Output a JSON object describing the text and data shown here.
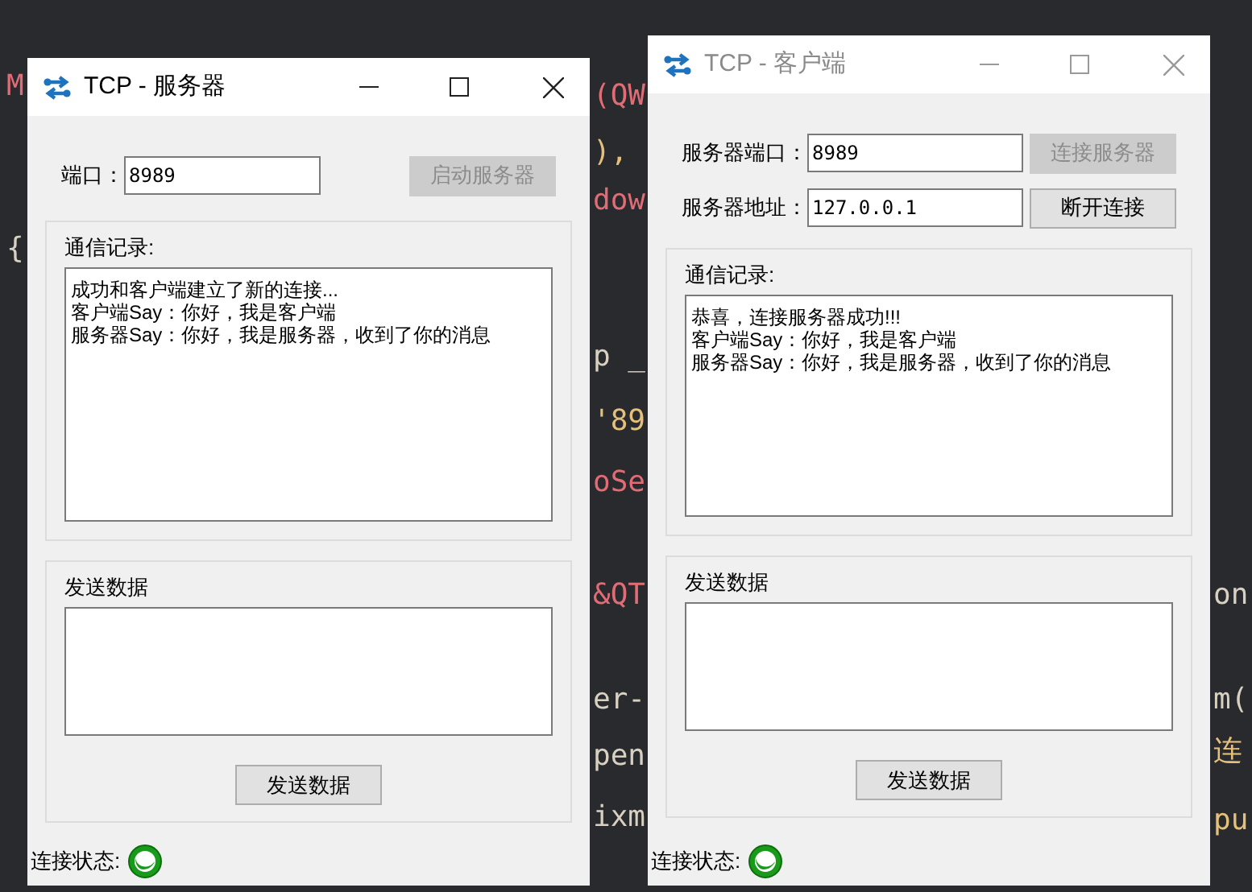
{
  "editor": {
    "code_fragments": [
      "M",
      "{",
      "(QW",
      "),",
      "dow",
      "p _",
      "'89",
      "oSe",
      "&QT",
      "er-",
      "pen",
      "ixm",
      "on",
      "m(",
      "连",
      "pu"
    ]
  },
  "windows": [
    {
      "title": "TCP - 服务器",
      "active": true,
      "rows": [
        {
          "label": "端口：",
          "value": "8989",
          "button": {
            "label": "启动服务器",
            "disabled": true
          }
        }
      ],
      "log_group": {
        "title": "通信记录:",
        "lines": [
          "成功和客户端建立了新的连接...",
          "客户端Say：你好，我是客户端",
          "服务器Say：你好，我是服务器，收到了你的消息"
        ]
      },
      "send_group": {
        "title": "发送数据",
        "button": {
          "label": "发送数据",
          "disabled": false
        }
      },
      "status": {
        "label": "连接状态:"
      }
    },
    {
      "title": "TCP - 客户端",
      "active": false,
      "rows": [
        {
          "label": "服务器端口：",
          "value": "8989",
          "button": {
            "label": "连接服务器",
            "disabled": true
          }
        },
        {
          "label": "服务器地址：",
          "value": "127.0.0.1",
          "button": {
            "label": "断开连接",
            "disabled": false
          }
        }
      ],
      "log_group": {
        "title": "通信记录:",
        "lines": [
          "恭喜，连接服务器成功!!!",
          "客户端Say：你好，我是客户端",
          "服务器Say：你好，我是服务器，收到了你的消息"
        ]
      },
      "send_group": {
        "title": "发送数据",
        "button": {
          "label": "发送数据",
          "disabled": false
        }
      },
      "status": {
        "label": "连接状态:"
      }
    }
  ]
}
